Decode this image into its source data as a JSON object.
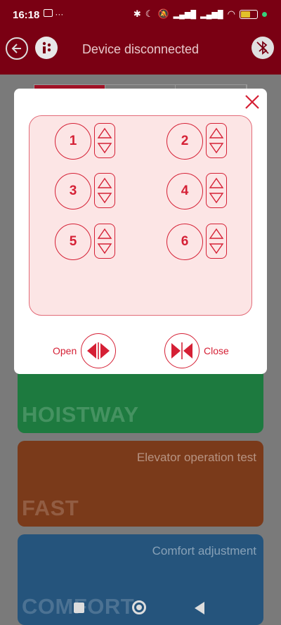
{
  "status_bar": {
    "time": "16:18",
    "notif_badge": "Zalo",
    "more": "···",
    "battery_level": "51",
    "battery_fill_pct": 55,
    "colors": {
      "battery": "#e2c12a",
      "dot": "#36d17a"
    }
  },
  "app_bar": {
    "title": "Device disconnected",
    "back_icon": "back-arrow-icon",
    "info_icon": "info-icon",
    "bluetooth_icon": "bluetooth-off-icon",
    "colors": {
      "background": "#7a0013"
    }
  },
  "tabs": {
    "count": 3,
    "active_index": 0
  },
  "cards": [
    {
      "subtitle": "",
      "title": "HOISTWAY",
      "color": "#1d7a3f"
    },
    {
      "subtitle": "Elevator operation test",
      "title": "FAST",
      "color": "#7a3a1a"
    },
    {
      "subtitle": "Comfort adjustment",
      "title": "COMFORT",
      "color": "#25547c"
    }
  ],
  "dialog": {
    "close_icon": "close-icon",
    "floors": [
      {
        "label": "1"
      },
      {
        "label": "2"
      },
      {
        "label": "3"
      },
      {
        "label": "4"
      },
      {
        "label": "5"
      },
      {
        "label": "6"
      }
    ],
    "open_label": "Open",
    "close_label": "Close",
    "colors": {
      "accent": "#d52035",
      "panel": "#fce5e5"
    }
  },
  "navbar": {
    "icons": [
      "recent-apps-icon",
      "home-icon",
      "back-icon"
    ]
  }
}
